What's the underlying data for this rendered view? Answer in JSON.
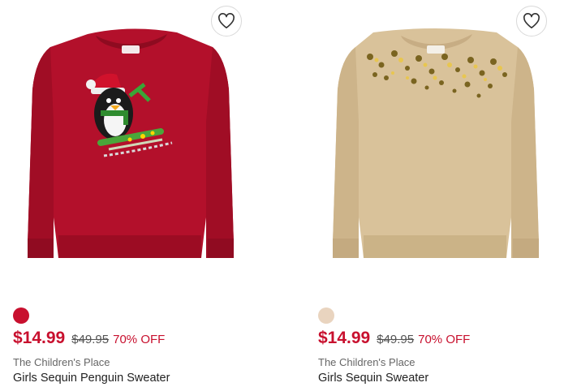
{
  "products": [
    {
      "sale_price": "$14.99",
      "original_price": "$49.95",
      "discount": "70% OFF",
      "brand": "The Children's Place",
      "title": "Girls Sequin Penguin Sweater",
      "swatch_color": "#c8102e",
      "sweater_color": "#b3102b",
      "icon": "heart-icon"
    },
    {
      "sale_price": "$14.99",
      "original_price": "$49.95",
      "discount": "70% OFF",
      "brand": "The Children's Place",
      "title": "Girls Sequin Sweater",
      "swatch_color": "#e9d4bf",
      "sweater_color": "#d9c29a",
      "icon": "heart-icon"
    }
  ],
  "colors": {
    "sale": "#c8102e",
    "text": "#222222",
    "muted": "#666666"
  }
}
